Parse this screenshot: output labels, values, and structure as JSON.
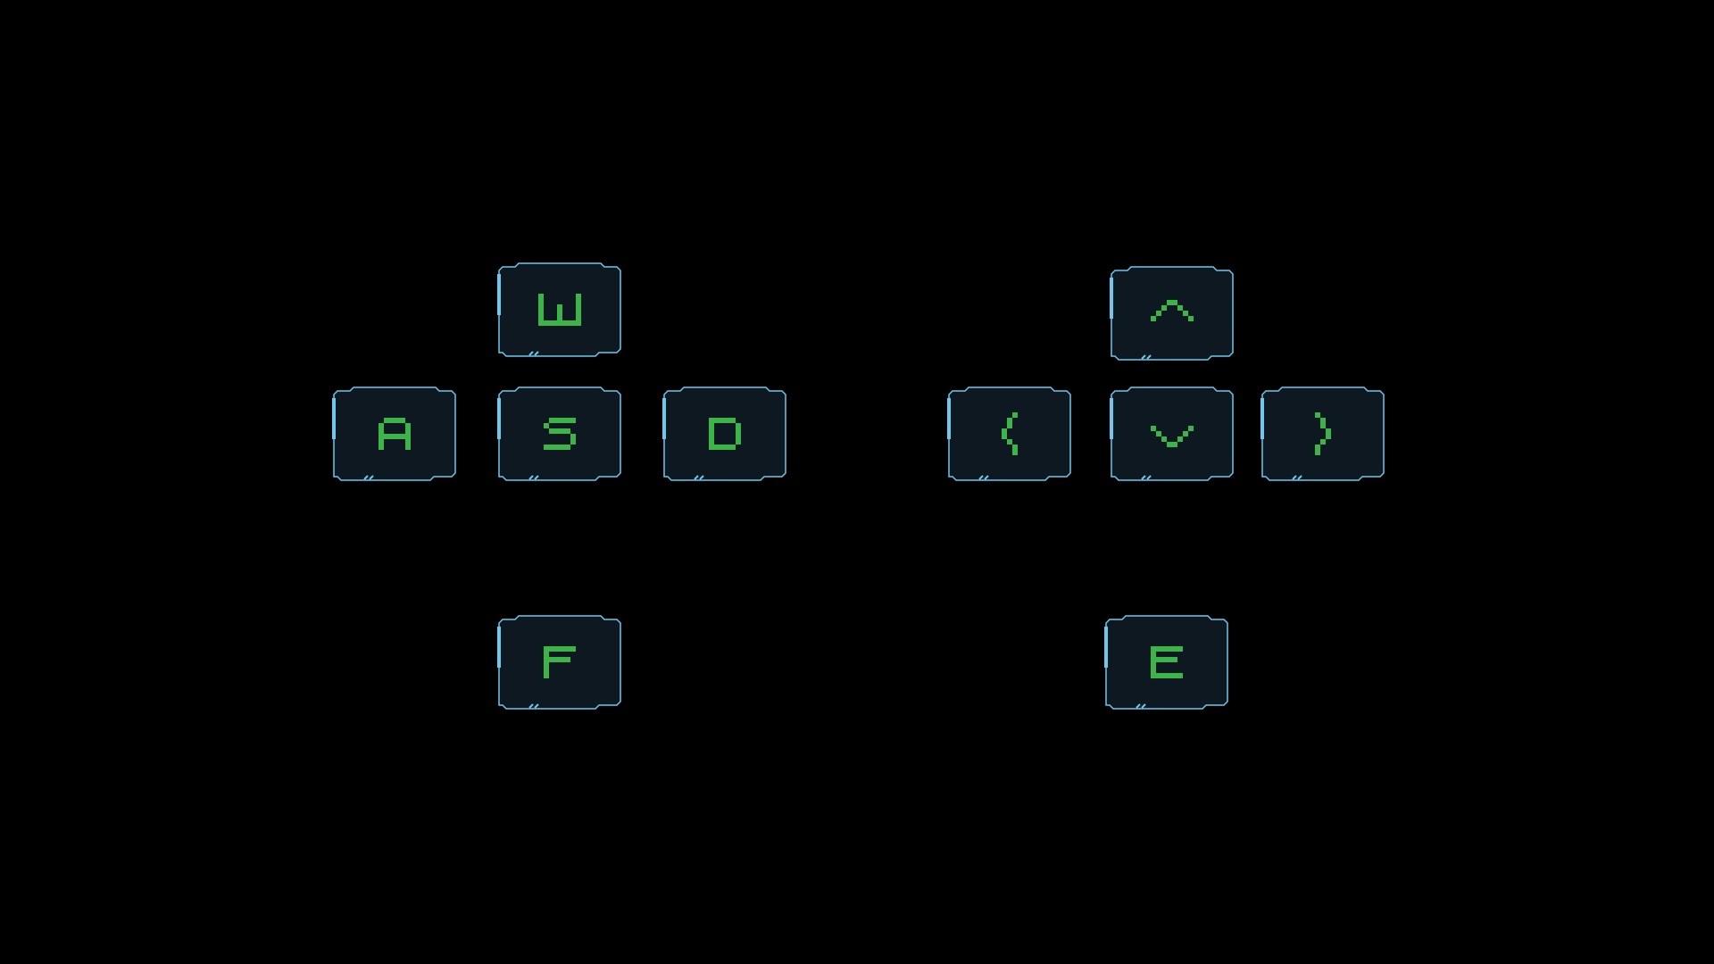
{
  "colors": {
    "background": "#000000",
    "key_fill": "#0e1820",
    "key_border": "#6fc8ec",
    "glyph": "#3cb44a"
  },
  "left_cluster": {
    "up": {
      "label": "W",
      "icon": "letter-w"
    },
    "left": {
      "label": "A",
      "icon": "letter-a"
    },
    "down": {
      "label": "S",
      "icon": "letter-s"
    },
    "right": {
      "label": "D",
      "icon": "letter-d"
    },
    "action": {
      "label": "F",
      "icon": "letter-f"
    }
  },
  "right_cluster": {
    "up": {
      "label": "^",
      "icon": "arrow-up-icon"
    },
    "left": {
      "label": "<",
      "icon": "arrow-left-icon"
    },
    "down": {
      "label": "v",
      "icon": "arrow-down-icon"
    },
    "right": {
      "label": ">",
      "icon": "arrow-right-icon"
    },
    "action": {
      "label": "E",
      "icon": "letter-e"
    }
  }
}
